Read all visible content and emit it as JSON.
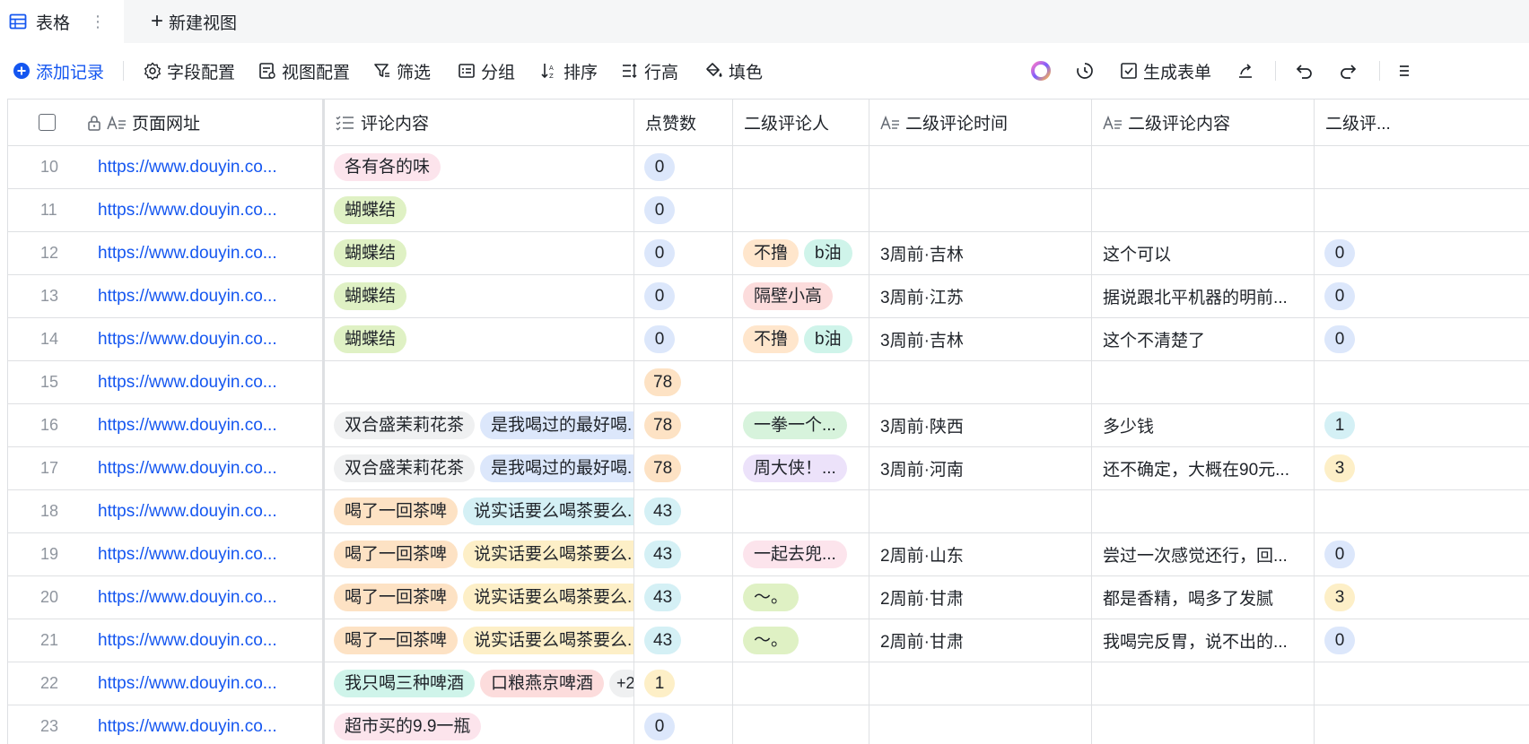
{
  "tabs": {
    "active_label": "表格",
    "new_view_label": "新建视图"
  },
  "toolbar": {
    "add_record": "添加记录",
    "field_config": "字段配置",
    "view_config": "视图配置",
    "filter": "筛选",
    "group": "分组",
    "sort": "排序",
    "row_height": "行高",
    "fill": "填色",
    "generate_form": "生成表单"
  },
  "columns": {
    "url": "页面网址",
    "comment": "评论内容",
    "likes": "点赞数",
    "sub_commenter": "二级评论人",
    "sub_time": "二级评论时间",
    "sub_content": "二级评论内容",
    "sub_more": "二级评..."
  },
  "colors": {
    "pink": "#fce4ec",
    "green": "#dff1c4",
    "orange": "#fde2c4",
    "yellow": "#fdefc7",
    "blue": "#dce7fb",
    "cyan": "#d4f0f5",
    "gray": "#eff0f1",
    "purple": "#ece2fa",
    "teal": "#cff4ea",
    "mint": "#d7f3dc",
    "rose": "#fcdcdc",
    "peach": "#ffe6cc",
    "accent": "#1456f0"
  },
  "rows": [
    {
      "n": "10",
      "url": "https://www.douyin.co...",
      "tags": [
        {
          "t": "各有各的味",
          "c": "pink"
        }
      ],
      "likes": {
        "v": "0",
        "c": "blue"
      },
      "people": [],
      "time": "",
      "content": "",
      "more": null
    },
    {
      "n": "11",
      "url": "https://www.douyin.co...",
      "tags": [
        {
          "t": "蝴蝶结",
          "c": "green"
        }
      ],
      "likes": {
        "v": "0",
        "c": "blue"
      },
      "people": [],
      "time": "",
      "content": "",
      "more": null
    },
    {
      "n": "12",
      "url": "https://www.douyin.co...",
      "tags": [
        {
          "t": "蝴蝶结",
          "c": "green"
        }
      ],
      "likes": {
        "v": "0",
        "c": "blue"
      },
      "people": [
        {
          "t": "不撸",
          "c": "peach"
        },
        {
          "t": "b油",
          "c": "teal"
        }
      ],
      "time": "3周前·吉林",
      "content": "这个可以",
      "more": {
        "v": "0",
        "c": "blue"
      }
    },
    {
      "n": "13",
      "url": "https://www.douyin.co...",
      "tags": [
        {
          "t": "蝴蝶结",
          "c": "green"
        }
      ],
      "likes": {
        "v": "0",
        "c": "blue"
      },
      "people": [
        {
          "t": "隔壁小高",
          "c": "rose"
        }
      ],
      "time": "3周前·江苏",
      "content": "据说跟北平机器的明前...",
      "more": {
        "v": "0",
        "c": "blue"
      }
    },
    {
      "n": "14",
      "url": "https://www.douyin.co...",
      "tags": [
        {
          "t": "蝴蝶结",
          "c": "green"
        }
      ],
      "likes": {
        "v": "0",
        "c": "blue"
      },
      "people": [
        {
          "t": "不撸",
          "c": "peach"
        },
        {
          "t": "b油",
          "c": "teal"
        }
      ],
      "time": "3周前·吉林",
      "content": "这个不清楚了",
      "more": {
        "v": "0",
        "c": "blue"
      }
    },
    {
      "n": "15",
      "url": "https://www.douyin.co...",
      "tags": [],
      "likes": {
        "v": "78",
        "c": "orange"
      },
      "people": [],
      "time": "",
      "content": "",
      "more": null
    },
    {
      "n": "16",
      "url": "https://www.douyin.co...",
      "tags": [
        {
          "t": "双合盛茉莉花茶",
          "c": "gray"
        },
        {
          "t": "是我喝过的最好喝...",
          "c": "blue"
        }
      ],
      "likes": {
        "v": "78",
        "c": "orange"
      },
      "people": [
        {
          "t": "一拳一个...",
          "c": "mint"
        }
      ],
      "time": "3周前·陕西",
      "content": "多少钱",
      "more": {
        "v": "1",
        "c": "cyan"
      }
    },
    {
      "n": "17",
      "url": "https://www.douyin.co...",
      "tags": [
        {
          "t": "双合盛茉莉花茶",
          "c": "gray"
        },
        {
          "t": "是我喝过的最好喝...",
          "c": "blue"
        }
      ],
      "likes": {
        "v": "78",
        "c": "orange"
      },
      "people": [
        {
          "t": "周大侠！...",
          "c": "purple"
        }
      ],
      "time": "3周前·河南",
      "content": "还不确定，大概在90元...",
      "more": {
        "v": "3",
        "c": "yellow"
      }
    },
    {
      "n": "18",
      "url": "https://www.douyin.co...",
      "tags": [
        {
          "t": "喝了一回茶啤",
          "c": "orange"
        },
        {
          "t": "说实话要么喝茶要么...",
          "c": "cyan"
        }
      ],
      "likes": {
        "v": "43",
        "c": "cyan"
      },
      "people": [],
      "time": "",
      "content": "",
      "more": null
    },
    {
      "n": "19",
      "url": "https://www.douyin.co...",
      "tags": [
        {
          "t": "喝了一回茶啤",
          "c": "orange"
        },
        {
          "t": "说实话要么喝茶要么...",
          "c": "yellow"
        }
      ],
      "likes": {
        "v": "43",
        "c": "cyan"
      },
      "people": [
        {
          "t": "一起去兜...",
          "c": "pink"
        }
      ],
      "time": "2周前·山东",
      "content": "尝过一次感觉还行，回...",
      "more": {
        "v": "0",
        "c": "blue"
      }
    },
    {
      "n": "20",
      "url": "https://www.douyin.co...",
      "tags": [
        {
          "t": "喝了一回茶啤",
          "c": "orange"
        },
        {
          "t": "说实话要么喝茶要么...",
          "c": "yellow"
        }
      ],
      "likes": {
        "v": "43",
        "c": "cyan"
      },
      "people": [
        {
          "t": "～。",
          "c": "green"
        }
      ],
      "time": "2周前·甘肃",
      "content": "都是香精，喝多了发腻",
      "more": {
        "v": "3",
        "c": "yellow"
      }
    },
    {
      "n": "21",
      "url": "https://www.douyin.co...",
      "tags": [
        {
          "t": "喝了一回茶啤",
          "c": "orange"
        },
        {
          "t": "说实话要么喝茶要么...",
          "c": "yellow"
        }
      ],
      "likes": {
        "v": "43",
        "c": "cyan"
      },
      "people": [
        {
          "t": "～。",
          "c": "green"
        }
      ],
      "time": "2周前·甘肃",
      "content": "我喝完反胃，说不出的...",
      "more": {
        "v": "0",
        "c": "blue"
      }
    },
    {
      "n": "22",
      "url": "https://www.douyin.co...",
      "tags": [
        {
          "t": "我只喝三种啤酒",
          "c": "teal"
        },
        {
          "t": "口粮燕京啤酒",
          "c": "rose"
        }
      ],
      "extra": "+2",
      "likes": {
        "v": "1",
        "c": "yellow"
      },
      "people": [],
      "time": "",
      "content": "",
      "more": null
    },
    {
      "n": "23",
      "url": "https://www.douyin.co...",
      "tags": [
        {
          "t": "超市买的9.9一瓶",
          "c": "pink"
        }
      ],
      "likes": {
        "v": "0",
        "c": "blue"
      },
      "people": [],
      "time": "",
      "content": "",
      "more": null
    }
  ]
}
